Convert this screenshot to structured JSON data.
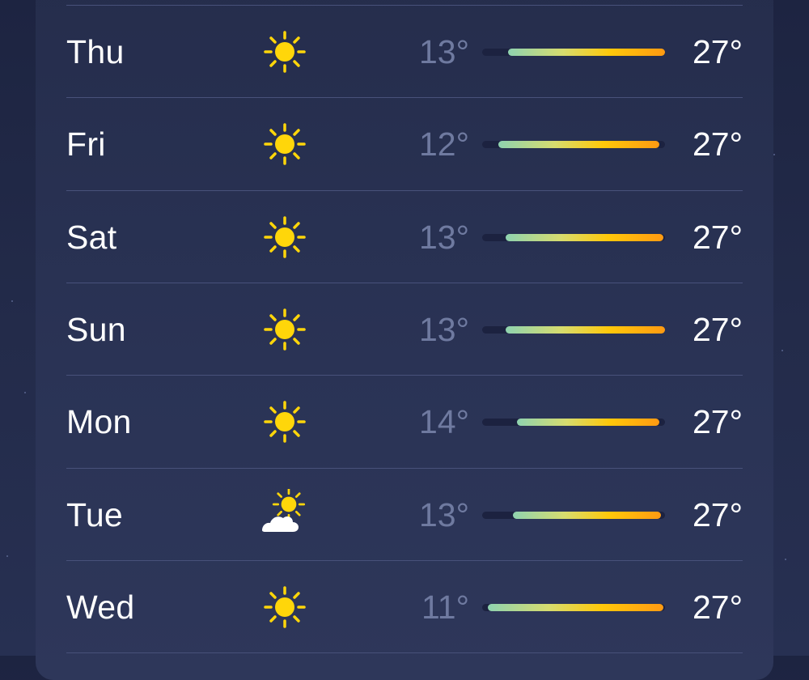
{
  "forecast": [
    {
      "day": "Thu",
      "icon": "sun-icon",
      "low": "13°",
      "high": "27°",
      "bar_start": 0.14,
      "bar_end": 1.0
    },
    {
      "day": "Fri",
      "icon": "sun-icon",
      "low": "12°",
      "high": "27°",
      "bar_start": 0.09,
      "bar_end": 0.97
    },
    {
      "day": "Sat",
      "icon": "sun-icon",
      "low": "13°",
      "high": "27°",
      "bar_start": 0.13,
      "bar_end": 0.99
    },
    {
      "day": "Sun",
      "icon": "sun-icon",
      "low": "13°",
      "high": "27°",
      "bar_start": 0.13,
      "bar_end": 1.0
    },
    {
      "day": "Mon",
      "icon": "sun-icon",
      "low": "14°",
      "high": "27°",
      "bar_start": 0.19,
      "bar_end": 0.97
    },
    {
      "day": "Tue",
      "icon": "partly-cloudy-icon",
      "low": "13°",
      "high": "27°",
      "bar_start": 0.17,
      "bar_end": 0.98
    },
    {
      "day": "Wed",
      "icon": "sun-icon",
      "low": "11°",
      "high": "27°",
      "bar_start": 0.03,
      "bar_end": 0.99
    }
  ],
  "colors": {
    "sun": "#ffd60a",
    "cloud": "#ffffff",
    "low_temp": "#6f7aa0",
    "bar_cool": "#8fd3b0",
    "bar_warm": "#ff9a12"
  }
}
